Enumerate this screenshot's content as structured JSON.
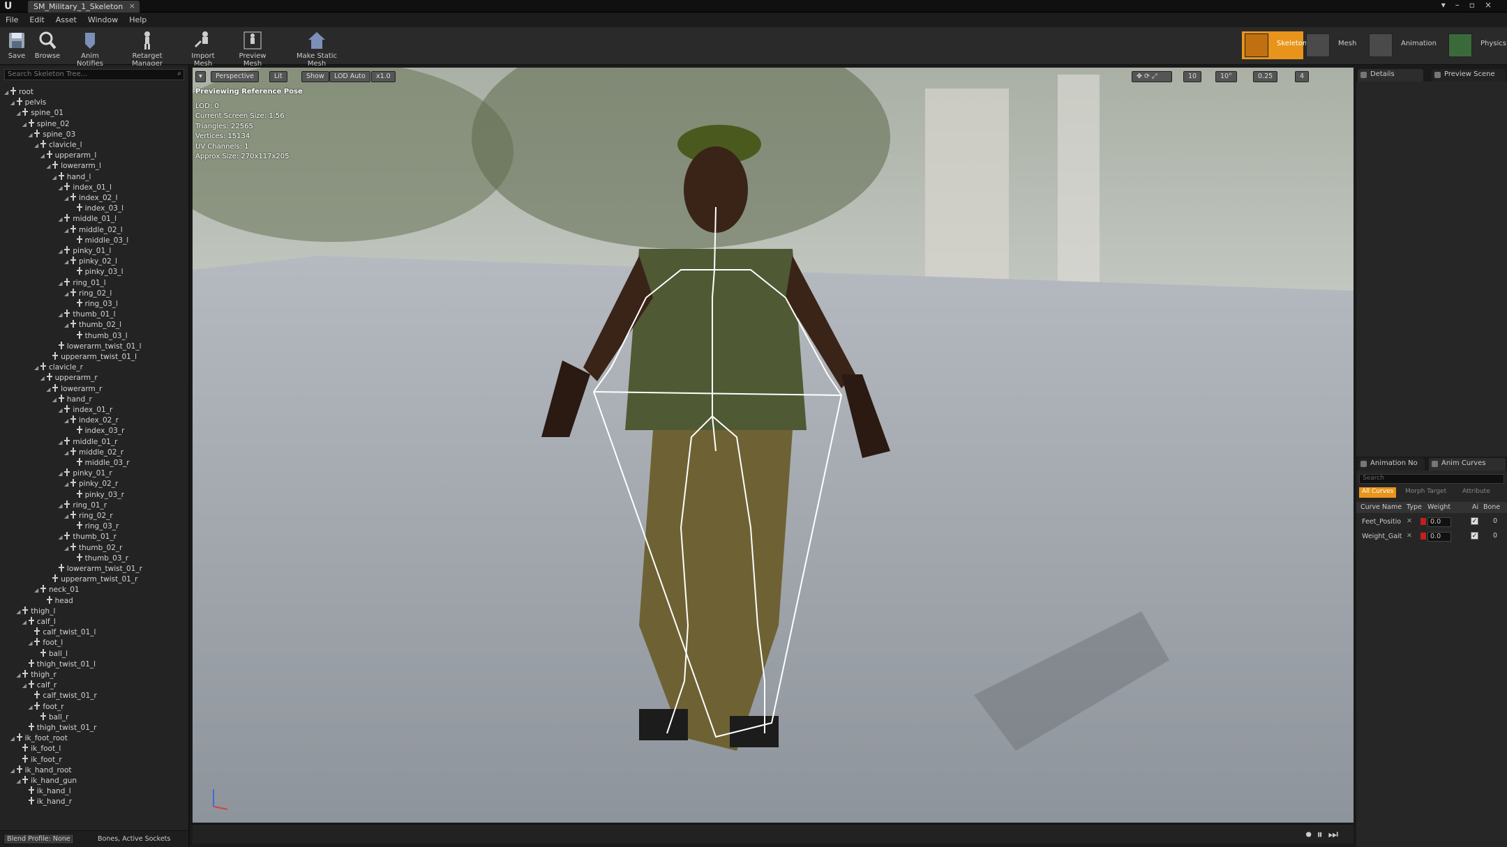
{
  "window": {
    "tab_title": "SM_Military_1_Skeleton",
    "close": "×"
  },
  "menu": [
    "File",
    "Edit",
    "Asset",
    "Window",
    "Help"
  ],
  "toolbar": {
    "buttons": [
      "Save",
      "Browse",
      "Anim Notifies",
      "Retarget Manager",
      "Import Mesh",
      "Preview Mesh",
      "Make Static Mesh"
    ],
    "modes": [
      "Skeleton",
      "Mesh",
      "Animation",
      "Physics"
    ]
  },
  "skeleton_tree": {
    "search_placeholder": "Search Skeleton Tree...",
    "bones": [
      {
        "name": "root",
        "depth": 0,
        "exp": true
      },
      {
        "name": "pelvis",
        "depth": 1,
        "exp": true
      },
      {
        "name": "spine_01",
        "depth": 2,
        "exp": true
      },
      {
        "name": "spine_02",
        "depth": 3,
        "exp": true
      },
      {
        "name": "spine_03",
        "depth": 4,
        "exp": true
      },
      {
        "name": "clavicle_l",
        "depth": 5,
        "exp": true
      },
      {
        "name": "upperarm_l",
        "depth": 6,
        "exp": true
      },
      {
        "name": "lowerarm_l",
        "depth": 7,
        "exp": true
      },
      {
        "name": "hand_l",
        "depth": 8,
        "exp": true
      },
      {
        "name": "index_01_l",
        "depth": 9,
        "exp": true
      },
      {
        "name": "index_02_l",
        "depth": 10,
        "exp": true
      },
      {
        "name": "index_03_l",
        "depth": 11,
        "exp": false
      },
      {
        "name": "middle_01_l",
        "depth": 9,
        "exp": true
      },
      {
        "name": "middle_02_l",
        "depth": 10,
        "exp": true
      },
      {
        "name": "middle_03_l",
        "depth": 11,
        "exp": false
      },
      {
        "name": "pinky_01_l",
        "depth": 9,
        "exp": true
      },
      {
        "name": "pinky_02_l",
        "depth": 10,
        "exp": true
      },
      {
        "name": "pinky_03_l",
        "depth": 11,
        "exp": false
      },
      {
        "name": "ring_01_l",
        "depth": 9,
        "exp": true
      },
      {
        "name": "ring_02_l",
        "depth": 10,
        "exp": true
      },
      {
        "name": "ring_03_l",
        "depth": 11,
        "exp": false
      },
      {
        "name": "thumb_01_l",
        "depth": 9,
        "exp": true
      },
      {
        "name": "thumb_02_l",
        "depth": 10,
        "exp": true
      },
      {
        "name": "thumb_03_l",
        "depth": 11,
        "exp": false
      },
      {
        "name": "lowerarm_twist_01_l",
        "depth": 8,
        "exp": false
      },
      {
        "name": "upperarm_twist_01_l",
        "depth": 7,
        "exp": false
      },
      {
        "name": "clavicle_r",
        "depth": 5,
        "exp": true
      },
      {
        "name": "upperarm_r",
        "depth": 6,
        "exp": true
      },
      {
        "name": "lowerarm_r",
        "depth": 7,
        "exp": true
      },
      {
        "name": "hand_r",
        "depth": 8,
        "exp": true
      },
      {
        "name": "index_01_r",
        "depth": 9,
        "exp": true
      },
      {
        "name": "index_02_r",
        "depth": 10,
        "exp": true
      },
      {
        "name": "index_03_r",
        "depth": 11,
        "exp": false
      },
      {
        "name": "middle_01_r",
        "depth": 9,
        "exp": true
      },
      {
        "name": "middle_02_r",
        "depth": 10,
        "exp": true
      },
      {
        "name": "middle_03_r",
        "depth": 11,
        "exp": false
      },
      {
        "name": "pinky_01_r",
        "depth": 9,
        "exp": true
      },
      {
        "name": "pinky_02_r",
        "depth": 10,
        "exp": true
      },
      {
        "name": "pinky_03_r",
        "depth": 11,
        "exp": false
      },
      {
        "name": "ring_01_r",
        "depth": 9,
        "exp": true
      },
      {
        "name": "ring_02_r",
        "depth": 10,
        "exp": true
      },
      {
        "name": "ring_03_r",
        "depth": 11,
        "exp": false
      },
      {
        "name": "thumb_01_r",
        "depth": 9,
        "exp": true
      },
      {
        "name": "thumb_02_r",
        "depth": 10,
        "exp": true
      },
      {
        "name": "thumb_03_r",
        "depth": 11,
        "exp": false
      },
      {
        "name": "lowerarm_twist_01_r",
        "depth": 8,
        "exp": false
      },
      {
        "name": "upperarm_twist_01_r",
        "depth": 7,
        "exp": false
      },
      {
        "name": "neck_01",
        "depth": 5,
        "exp": true
      },
      {
        "name": "head",
        "depth": 6,
        "exp": false
      },
      {
        "name": "thigh_l",
        "depth": 2,
        "exp": true
      },
      {
        "name": "calf_l",
        "depth": 3,
        "exp": true
      },
      {
        "name": "calf_twist_01_l",
        "depth": 4,
        "exp": false
      },
      {
        "name": "foot_l",
        "depth": 4,
        "exp": true
      },
      {
        "name": "ball_l",
        "depth": 5,
        "exp": false
      },
      {
        "name": "thigh_twist_01_l",
        "depth": 3,
        "exp": false
      },
      {
        "name": "thigh_r",
        "depth": 2,
        "exp": true
      },
      {
        "name": "calf_r",
        "depth": 3,
        "exp": true
      },
      {
        "name": "calf_twist_01_r",
        "depth": 4,
        "exp": false
      },
      {
        "name": "foot_r",
        "depth": 4,
        "exp": true
      },
      {
        "name": "ball_r",
        "depth": 5,
        "exp": false
      },
      {
        "name": "thigh_twist_01_r",
        "depth": 3,
        "exp": false
      },
      {
        "name": "ik_foot_root",
        "depth": 1,
        "exp": true
      },
      {
        "name": "ik_foot_l",
        "depth": 2,
        "exp": false
      },
      {
        "name": "ik_foot_r",
        "depth": 2,
        "exp": false
      },
      {
        "name": "ik_hand_root",
        "depth": 1,
        "exp": true
      },
      {
        "name": "ik_hand_gun",
        "depth": 2,
        "exp": true
      },
      {
        "name": "ik_hand_l",
        "depth": 3,
        "exp": false
      },
      {
        "name": "ik_hand_r",
        "depth": 3,
        "exp": false
      }
    ],
    "blend_profile": "Blend Profile: None",
    "bones_filter": "Bones, Active Sockets"
  },
  "viewport": {
    "perspective": "Perspective",
    "lit": "Lit",
    "show": "Show",
    "lod": "LOD Auto",
    "speed": "x1.0",
    "grid_snap": "10",
    "rot_snap": "10°",
    "scale_snap": "0.25",
    "cam_speed": "4",
    "info": {
      "title": "Previewing Reference Pose",
      "lod": "LOD: 0",
      "screen_size": "Current Screen Size: 1.56",
      "triangles": "Triangles: 22565",
      "vertices": "Vertices: 15134",
      "uv": "UV Channels: 1",
      "approx": "Approx Size: 270x117x205"
    }
  },
  "details": {
    "tab1": "Details",
    "tab2": "Preview Scene"
  },
  "curves": {
    "tab1": "Animation No",
    "tab2": "Anim Curves",
    "search": "Search",
    "filters": [
      "All Curves",
      "Morph Target",
      "Attribute"
    ],
    "columns": [
      "Curve Name",
      "Type",
      "Weight",
      "Ai",
      "Bone"
    ],
    "rows": [
      {
        "name": "Feet_Positio",
        "weight": "0.0",
        "bones": "0"
      },
      {
        "name": "Weight_Gait",
        "weight": "0.0",
        "bones": "0"
      }
    ]
  },
  "colors": {
    "accent": "#e8941a",
    "panel": "#262626",
    "viewport_bg": "#9ea3a8"
  }
}
